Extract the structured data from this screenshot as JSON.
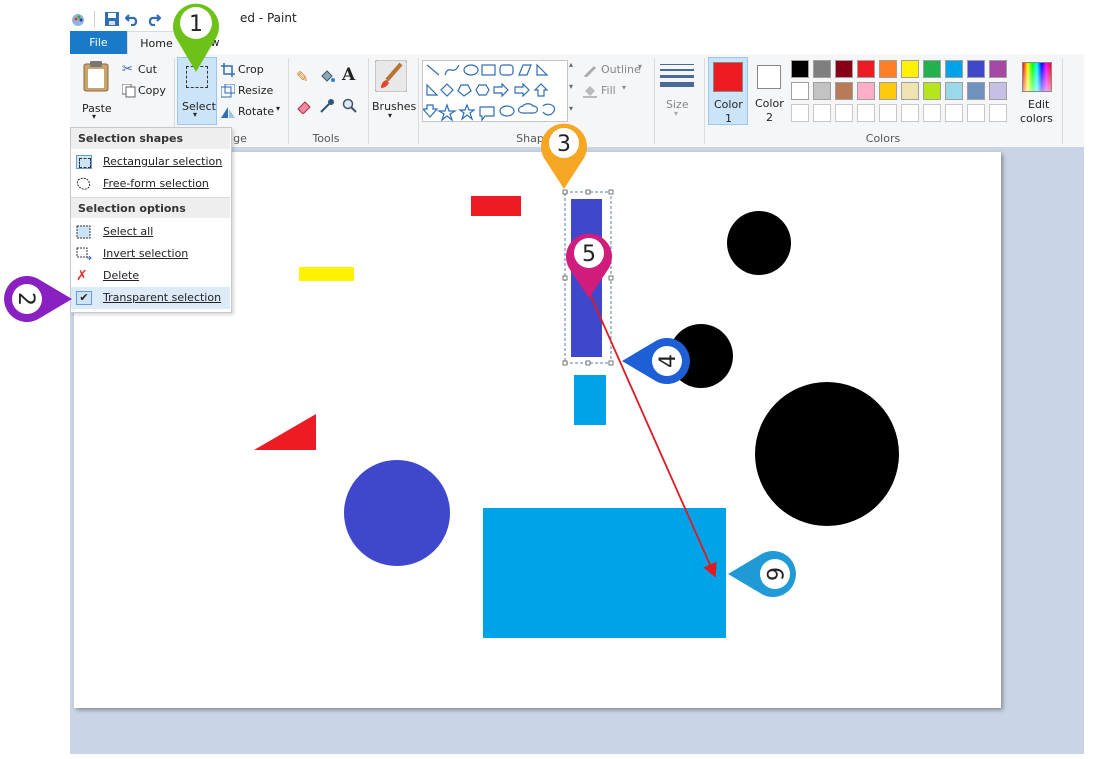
{
  "window": {
    "title": "ed - Paint"
  },
  "tabs": {
    "file": "File",
    "home": "Home",
    "view": "w"
  },
  "ribbon": {
    "clipboard": {
      "paste": "Paste",
      "cut": "Cut",
      "copy": "Copy"
    },
    "image": {
      "select": "Select",
      "crop": "Crop",
      "resize": "Resize",
      "rotate": "Rotate",
      "group_label": "ge"
    },
    "tools": {
      "group_label": "Tools"
    },
    "brushes": {
      "label": "Brushes"
    },
    "shapes": {
      "outline": "Outline",
      "fill": "Fill",
      "group_label": "Shap"
    },
    "size": {
      "label": "Size"
    },
    "colors": {
      "color1_line1": "Color",
      "color1_line2": "1",
      "color2_line1": "Color",
      "color2_line2": "2",
      "edit_line1": "Edit",
      "edit_line2": "colors",
      "group_label": "Colors",
      "color1_value": "#ed1c24",
      "color2_value": "#ffffff",
      "row1": [
        "#000000",
        "#7f7f7f",
        "#880015",
        "#ed1c24",
        "#ff7f27",
        "#fff200",
        "#22b14c",
        "#00a2e8",
        "#3f48cc",
        "#a349a4"
      ],
      "row2": [
        "#ffffff",
        "#c3c3c3",
        "#b97a57",
        "#ffaec9",
        "#ffc90e",
        "#efe4b0",
        "#b5e61d",
        "#99d9ea",
        "#7092be",
        "#c8bfe7"
      ],
      "row3": [
        "#ffffff",
        "#ffffff",
        "#ffffff",
        "#ffffff",
        "#ffffff",
        "#ffffff",
        "#ffffff",
        "#ffffff",
        "#ffffff",
        "#ffffff"
      ]
    }
  },
  "dropdown": {
    "shapes_header": "Selection shapes",
    "rect": "Rectangular selection",
    "freeform": "Free-form selection",
    "options_header": "Selection options",
    "select_all": "Select all",
    "invert": "Invert selection",
    "delete": "Delete",
    "transparent": "Transparent selection"
  },
  "markers": [
    "1",
    "2",
    "3",
    "4",
    "5",
    "6"
  ],
  "marker_colors": [
    "#6cc218",
    "#8a1fc2",
    "#f5a623",
    "#1e5fd6",
    "#d01c7a",
    "#1f9ad6"
  ]
}
